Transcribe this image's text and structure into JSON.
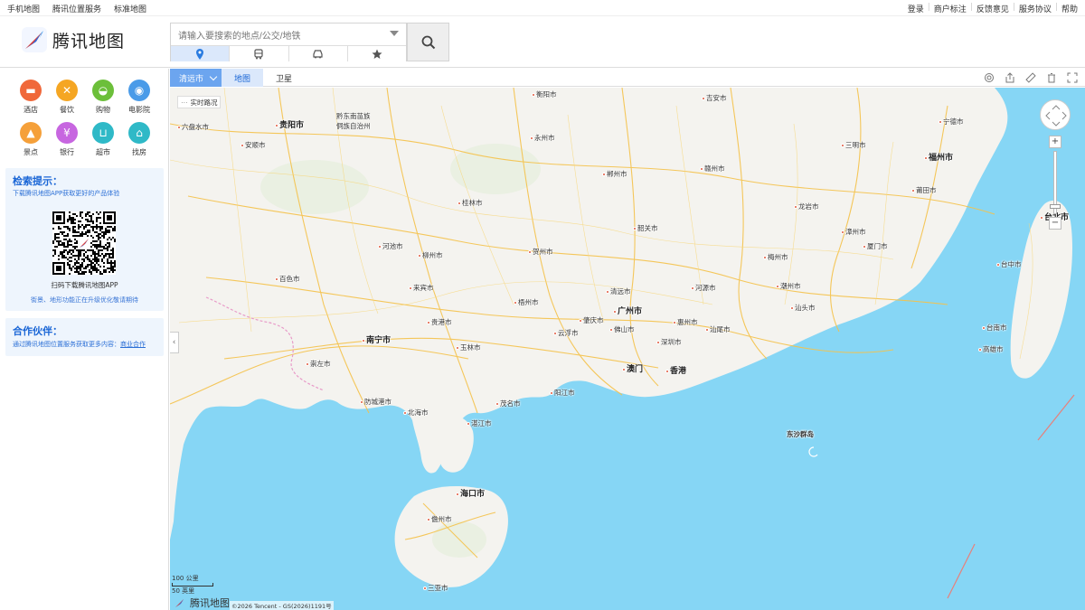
{
  "topbar": {
    "left_links": [
      "手机地图",
      "腾讯位置服务",
      "标准地图"
    ],
    "right_links": [
      "登录",
      "商户标注",
      "反馈意见",
      "服务协议",
      "帮助"
    ]
  },
  "header": {
    "logo_text": "腾讯地图",
    "search_placeholder": "请输入要搜索的地点/公交/地铁"
  },
  "sidebar": {
    "categories": [
      {
        "label": "酒店",
        "color": "#f0683a",
        "glyph": "▬"
      },
      {
        "label": "餐饮",
        "color": "#f5a623",
        "glyph": "✕"
      },
      {
        "label": "购物",
        "color": "#6cbf3a",
        "glyph": "◒"
      },
      {
        "label": "电影院",
        "color": "#4a9be8",
        "glyph": "◉"
      },
      {
        "label": "景点",
        "color": "#f5a03a",
        "glyph": "▲"
      },
      {
        "label": "银行",
        "color": "#c766e0",
        "glyph": "¥"
      },
      {
        "label": "超市",
        "color": "#2fb9c7",
        "glyph": "⊔"
      },
      {
        "label": "找房",
        "color": "#2fb9c7",
        "glyph": "⌂"
      }
    ],
    "tips": {
      "heading": "检索提示：",
      "subtitle": "下载腾讯地图APP获取更好的产品体验",
      "qr_caption": "扫码下载腾讯地图APP",
      "note": "街景、地形功能正在升级优化敬请期待"
    },
    "partner": {
      "heading": "合作伙伴：",
      "text": "通过腾讯地图位置服务获取更多内容：",
      "link": "商业合作"
    }
  },
  "maptabs": {
    "city": "清远市",
    "map_tab": "地图",
    "sat_tab": "卫星"
  },
  "map": {
    "traffic_label": "实时路况",
    "scale_km": "100 公里",
    "scale_mi": "50 英里",
    "brand": "腾讯地图",
    "copyright": "©2026 Tencent - GS(2026)1191号",
    "labels": {
      "guiyang": "贵阳市",
      "liupanshui": "六盘水市",
      "anshun": "安顺市",
      "qiandongnan": "黔东南苗族\n侗族自治州",
      "hengyang": "衡阳市",
      "jian": "吉安市",
      "yongzhou": "永州市",
      "sanming": "三明市",
      "ningde": "宁德市",
      "fuzhou": "福州市",
      "ganzhou": "赣州市",
      "chenzhou": "郴州市",
      "putian": "莆田市",
      "guilin": "桂林市",
      "longyan": "龙岩市",
      "taipei": "台北市",
      "shaoguan": "韶关市",
      "zhangzhou": "漳州市",
      "xiamen": "厦门市",
      "hechi": "河池市",
      "liuzhou": "柳州市",
      "hezhou": "贺州市",
      "meizhou": "梅州市",
      "taichung": "台中市",
      "baise": "百色市",
      "laibin": "来宾市",
      "qingyuan": "清远市",
      "heyuan": "河源市",
      "chaozhou": "潮州市",
      "wuzhou": "梧州市",
      "shantou": "汕头市",
      "guangzhou": "广州市",
      "zhaoqing": "肇庆市",
      "foshan": "佛山市",
      "huizhou": "惠州市",
      "nanning": "南宁市",
      "guigang": "贵港市",
      "yunfu": "云浮市",
      "shanwei": "汕尾市",
      "tainan": "台南市",
      "yulin": "玉林市",
      "shenzhen": "深圳市",
      "kaohsiung": "高雄市",
      "chongzuo": "崇左市",
      "macau": "澳门",
      "hongkong": "香港",
      "yangjiang": "阳江市",
      "maoming": "茂名市",
      "fangchenggang": "防城港市",
      "beihai": "北海市",
      "zhanjiang": "湛江市",
      "dongsha": "东沙群岛",
      "haikou": "海口市",
      "danzhou": "儋州市",
      "sanya": "三亚市"
    }
  }
}
